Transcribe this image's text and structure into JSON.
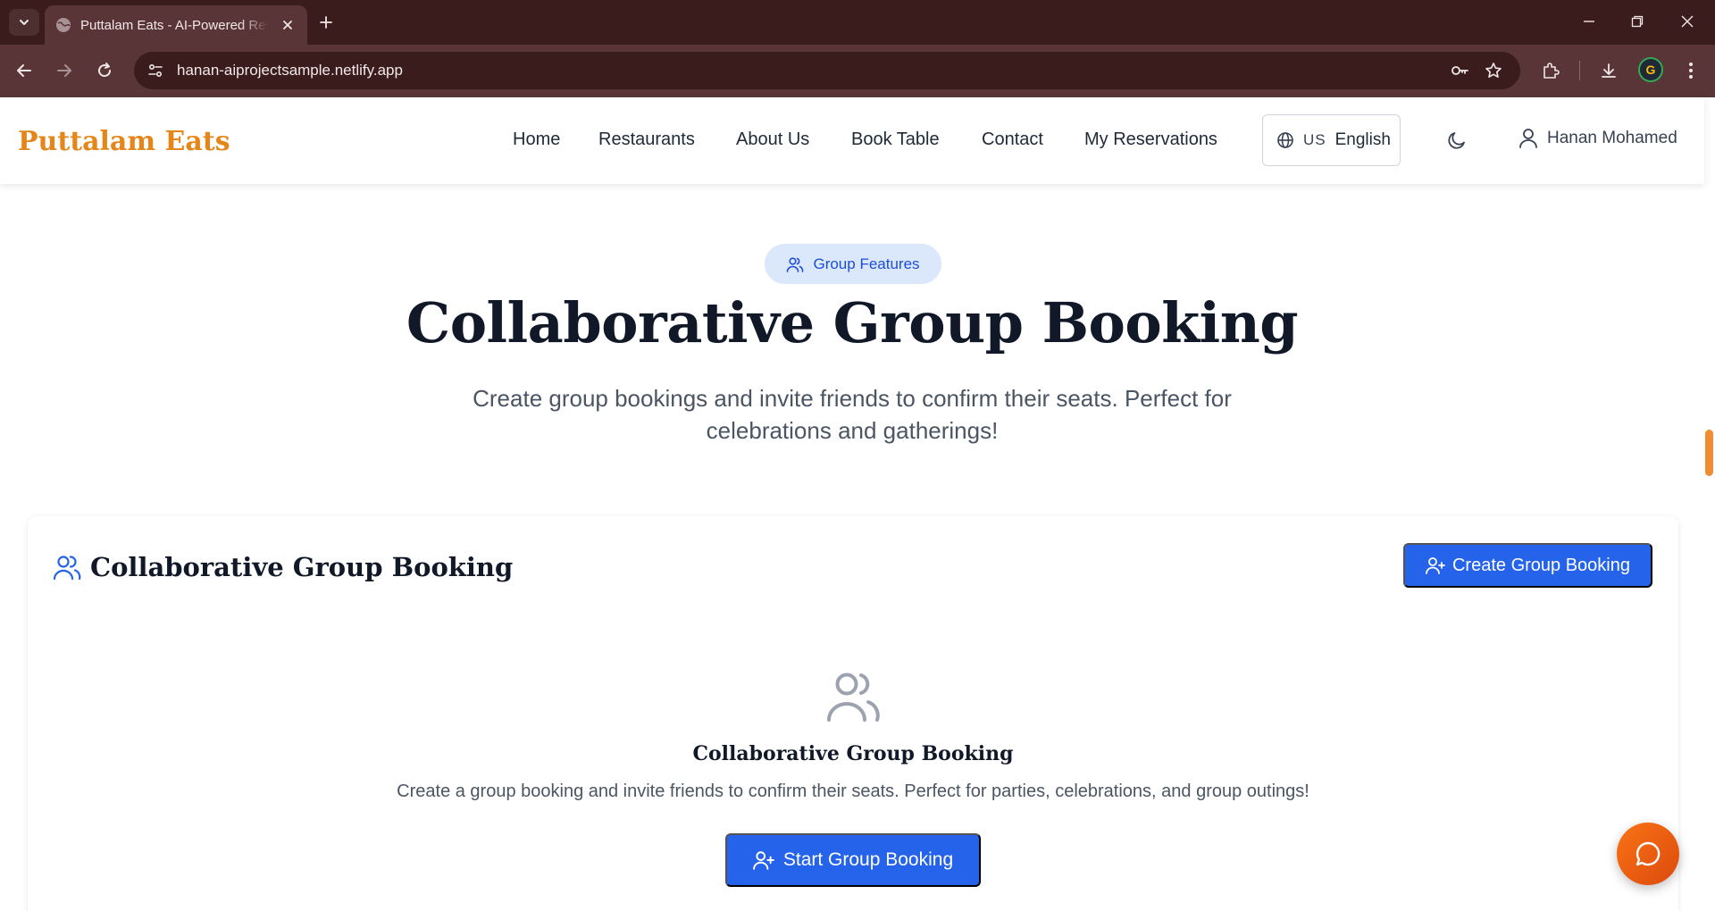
{
  "browser": {
    "tab_title": "Puttalam Eats - AI-Powered Restaurant Reservations",
    "url": "hanan-aiprojectsample.netlify.app",
    "icons": [
      "tab-list-icon",
      "globe-favicon-icon",
      "close-tab-icon",
      "new-tab-icon",
      "minimize-icon",
      "restore-icon",
      "close-window-icon",
      "back-icon",
      "forward-icon",
      "reload-icon",
      "site-info-icon",
      "password-key-icon",
      "bookmark-star-icon",
      "extensions-icon",
      "download-icon",
      "profile-avatar",
      "menu-kebab-icon"
    ]
  },
  "header": {
    "brand": "Puttalam Eats",
    "nav": [
      {
        "label": "Home"
      },
      {
        "label": "Restaurants"
      },
      {
        "label": "About Us"
      },
      {
        "label": "Book Table"
      },
      {
        "label": "Contact"
      },
      {
        "label": "My Reservations"
      }
    ],
    "language": {
      "code": "US",
      "label": "English"
    },
    "user_name": "Hanan Mohamed"
  },
  "hero": {
    "badge": "Group Features",
    "title": "Collaborative Group Booking",
    "subtitle": "Create group bookings and invite friends to confirm their seats. Perfect for celebrations and gatherings!"
  },
  "card": {
    "title": "Collaborative Group Booking",
    "create_button": "Create Group Booking",
    "empty_title": "Collaborative Group Booking",
    "empty_text": "Create a group booking and invite friends to confirm their seats. Perfect for parties, celebrations, and group outings!",
    "start_button": "Start Group Booking"
  },
  "colors": {
    "brand": "#e5861b",
    "primary": "#2563eb",
    "browser_frame": "#3a1c1d",
    "chat_fab": "#f97316"
  }
}
